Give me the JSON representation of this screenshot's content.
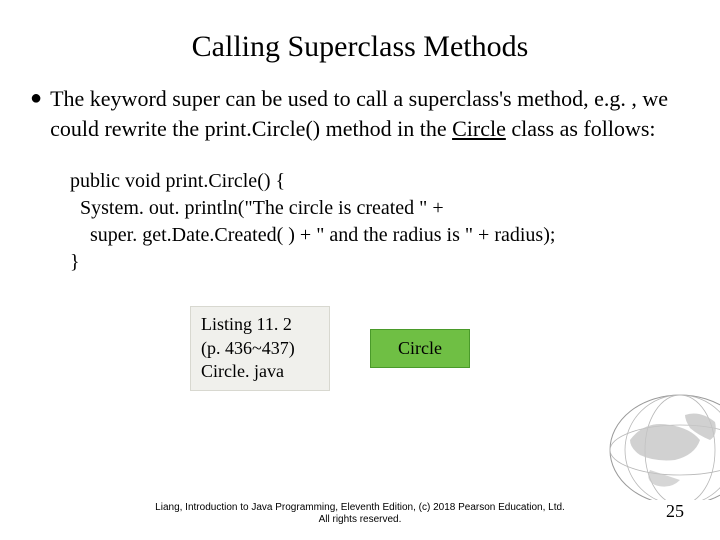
{
  "title": "Calling Superclass Methods",
  "bullet": {
    "part1": "The keyword super can be used to call a superclass's method, e.g. , we could rewrite the print.Circle() method in the ",
    "underlined": "Circle",
    "part2": " class as follows:"
  },
  "code": {
    "l1": "public void print.Circle() {",
    "l2": "  System. out. println(\"The circle is created \" +",
    "l3": "    super. get.Date.Created( ) + \" and the radius is \" + radius);",
    "l4": "}"
  },
  "box1": {
    "line1": "Listing 11. 2",
    "line2": "(p. 436~437)",
    "line3": "Circle. java"
  },
  "box2": "Circle",
  "footer": {
    "line1": "Liang, Introduction to Java Programming, Eleventh Edition, (c) 2018 Pearson Education, Ltd.",
    "line2": "All rights reserved."
  },
  "pagenum": "25"
}
